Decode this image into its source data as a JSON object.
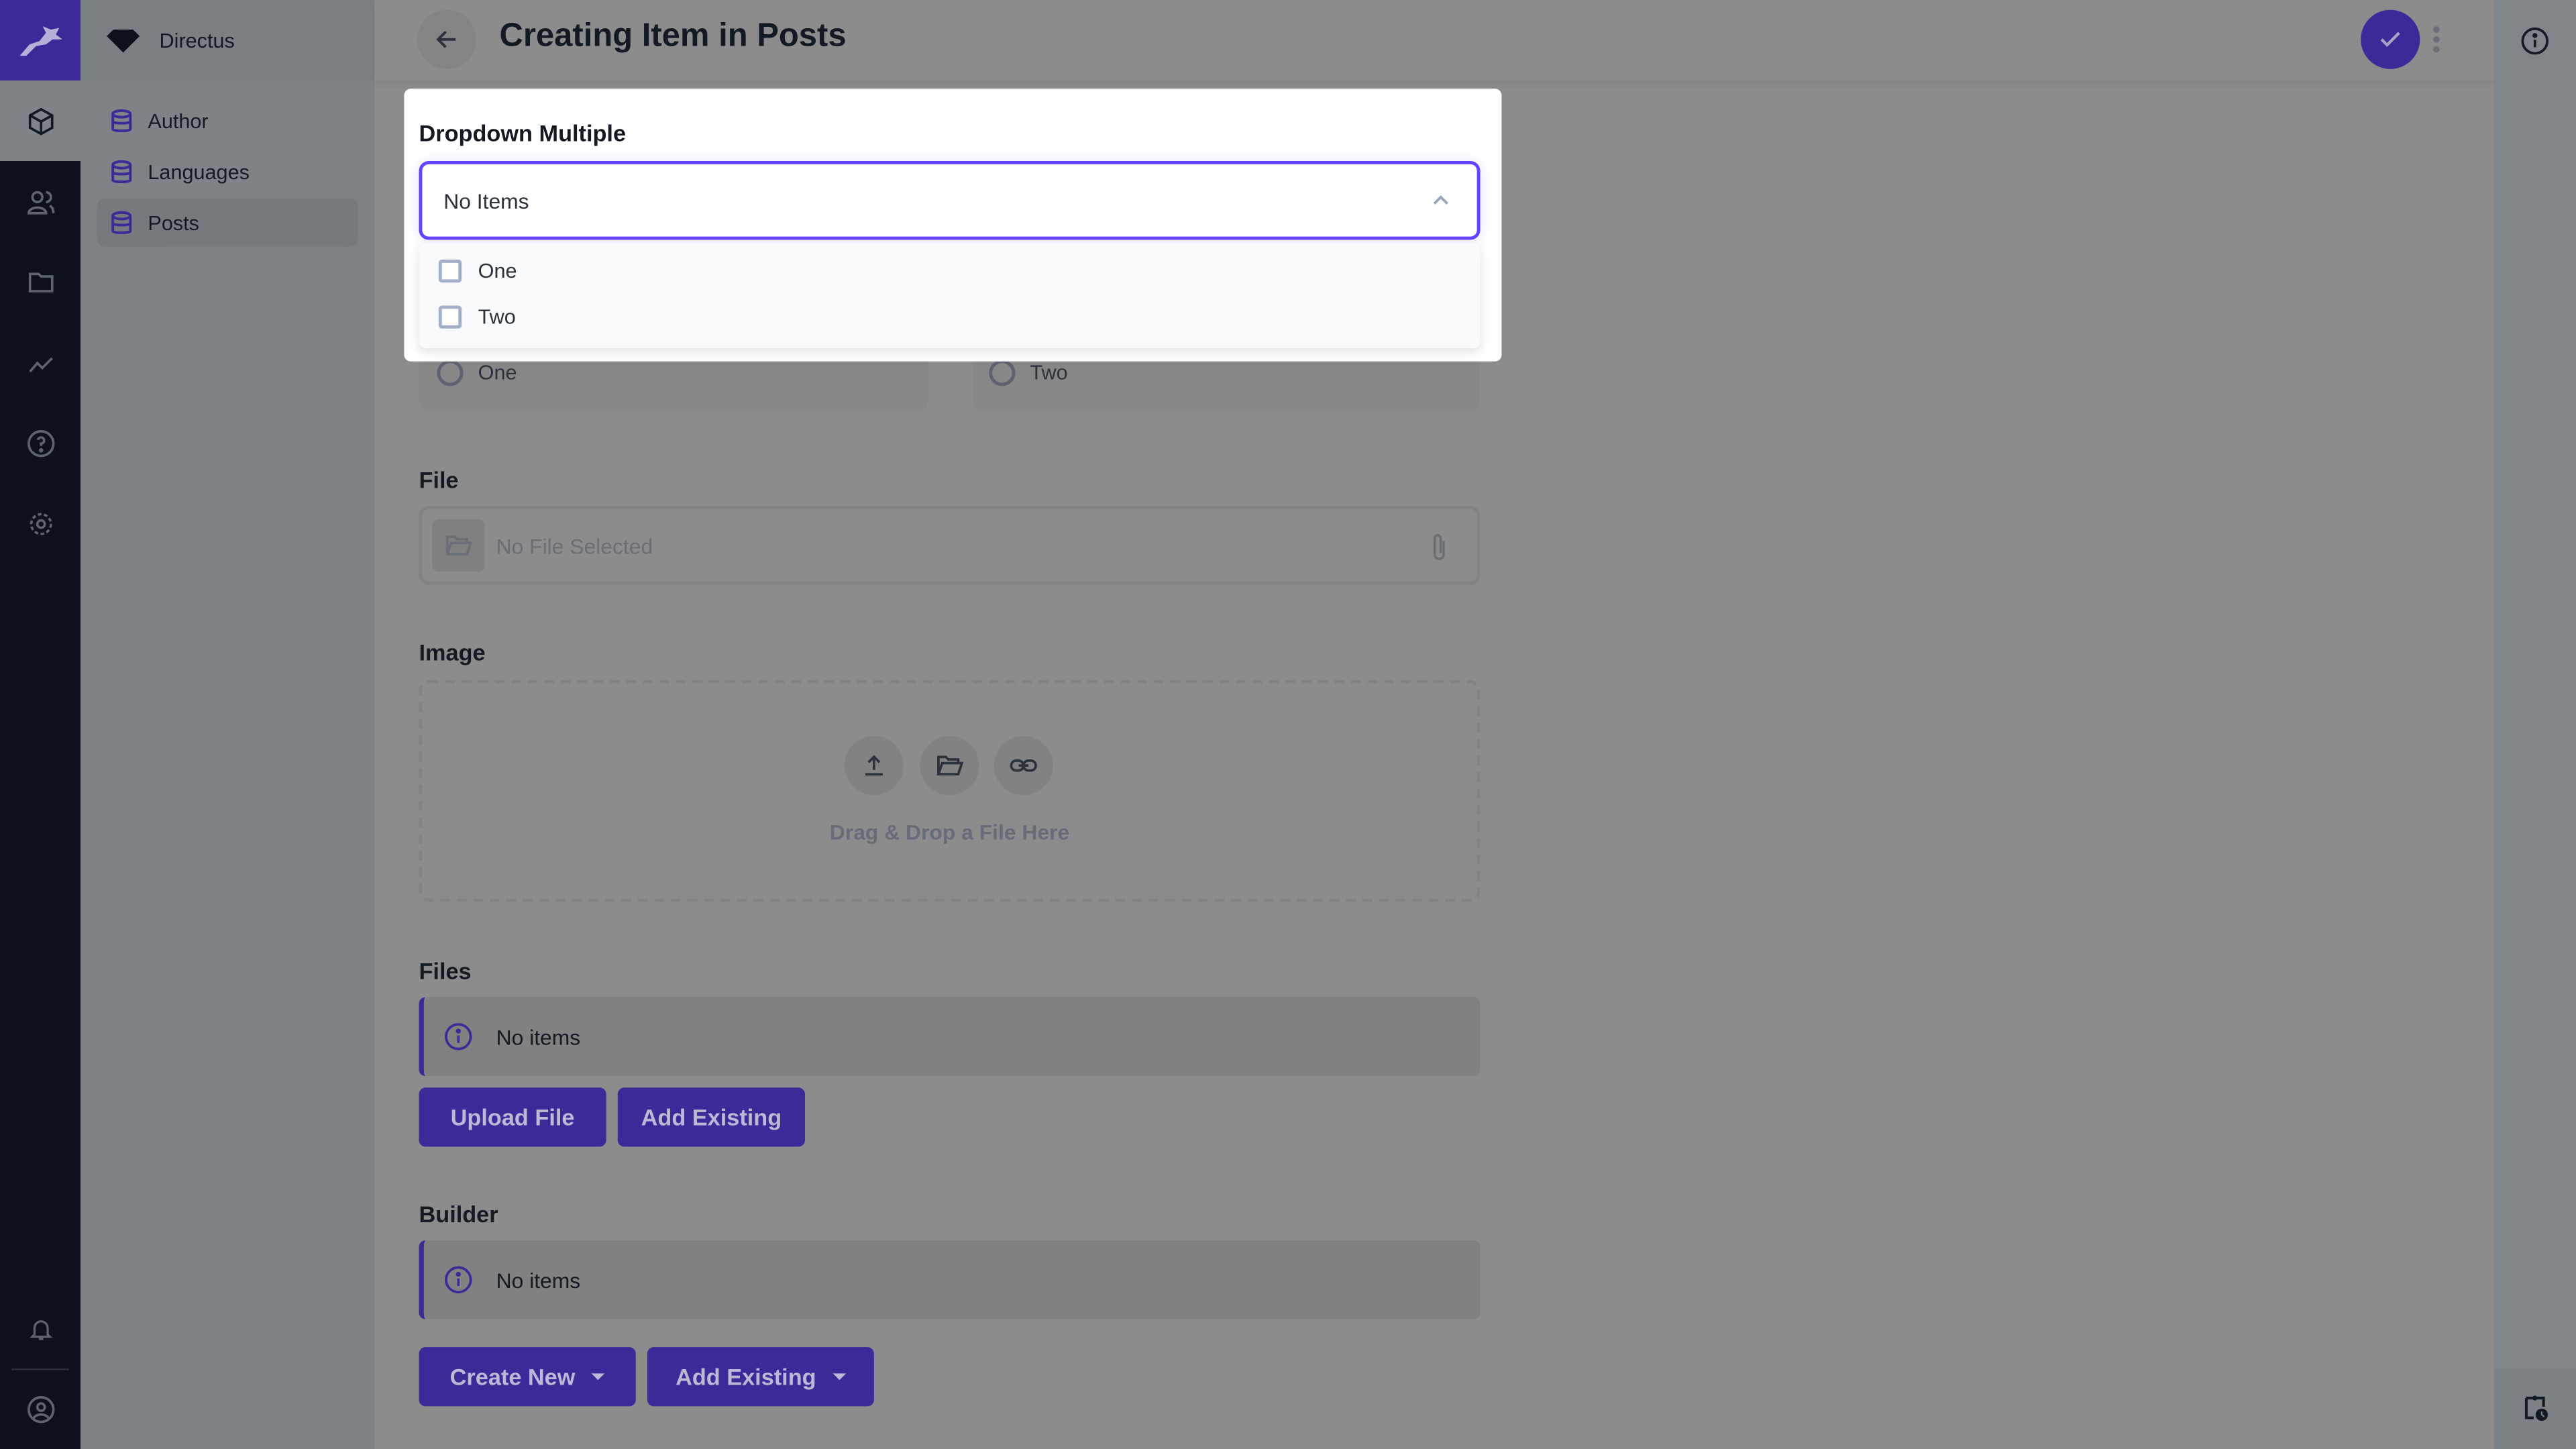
{
  "colors": {
    "accent": "#6644ff",
    "primary": "#3b2a98",
    "overlay": "#8c8c8c"
  },
  "project": {
    "name": "Directus"
  },
  "rail": {
    "icons": [
      "box-icon",
      "users-icon",
      "folder-icon",
      "insights-icon",
      "help-icon",
      "settings-icon",
      "bell-icon",
      "user-circle-icon"
    ]
  },
  "nav": {
    "items": [
      {
        "label": "Author"
      },
      {
        "label": "Languages"
      },
      {
        "label": "Posts"
      }
    ]
  },
  "header": {
    "title": "Creating Item in Posts"
  },
  "dropdown": {
    "label": "Dropdown Multiple",
    "placeholder": "No Items",
    "options": [
      {
        "label": "One",
        "checked": false
      },
      {
        "label": "Two",
        "checked": false
      }
    ]
  },
  "radios": [
    {
      "label": "One"
    },
    {
      "label": "Two"
    }
  ],
  "file": {
    "label": "File",
    "placeholder": "No File Selected"
  },
  "image": {
    "label": "Image",
    "drop_text": "Drag & Drop a File Here"
  },
  "files": {
    "label": "Files",
    "empty": "No items",
    "upload": "Upload File",
    "add_existing": "Add Existing"
  },
  "builder": {
    "label": "Builder",
    "empty": "No items",
    "create_new": "Create New",
    "add_existing": "Add Existing"
  }
}
